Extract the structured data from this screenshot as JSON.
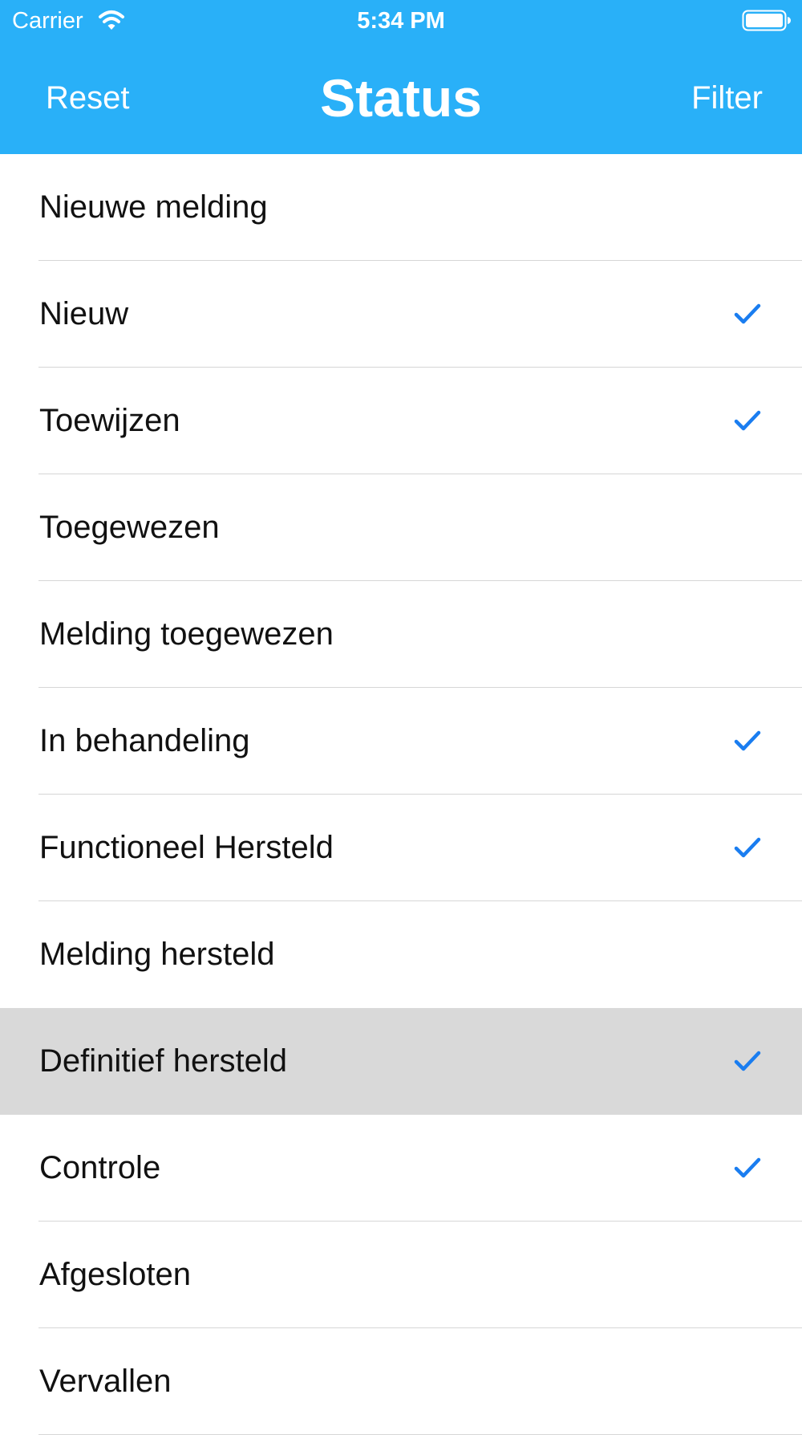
{
  "status_bar": {
    "carrier": "Carrier",
    "time": "5:34 PM",
    "icons": [
      "wifi-icon",
      "battery-icon"
    ]
  },
  "nav": {
    "left_label": "Reset",
    "title": "Status",
    "right_label": "Filter"
  },
  "colors": {
    "header_bg": "#29b0f8",
    "checkmark": "#1a7df0",
    "selected_row_bg": "#d9d9d9"
  },
  "items": [
    {
      "label": "Nieuwe melding",
      "checked": false,
      "highlighted": false
    },
    {
      "label": "Nieuw",
      "checked": true,
      "highlighted": false
    },
    {
      "label": "Toewijzen",
      "checked": true,
      "highlighted": false
    },
    {
      "label": "Toegewezen",
      "checked": false,
      "highlighted": false
    },
    {
      "label": "Melding toegewezen",
      "checked": false,
      "highlighted": false
    },
    {
      "label": "In behandeling",
      "checked": true,
      "highlighted": false
    },
    {
      "label": "Functioneel Hersteld",
      "checked": true,
      "highlighted": false
    },
    {
      "label": "Melding hersteld",
      "checked": false,
      "highlighted": false
    },
    {
      "label": "Definitief hersteld",
      "checked": true,
      "highlighted": true
    },
    {
      "label": "Controle",
      "checked": true,
      "highlighted": false
    },
    {
      "label": "Afgesloten",
      "checked": false,
      "highlighted": false
    },
    {
      "label": "Vervallen",
      "checked": false,
      "highlighted": false
    }
  ]
}
